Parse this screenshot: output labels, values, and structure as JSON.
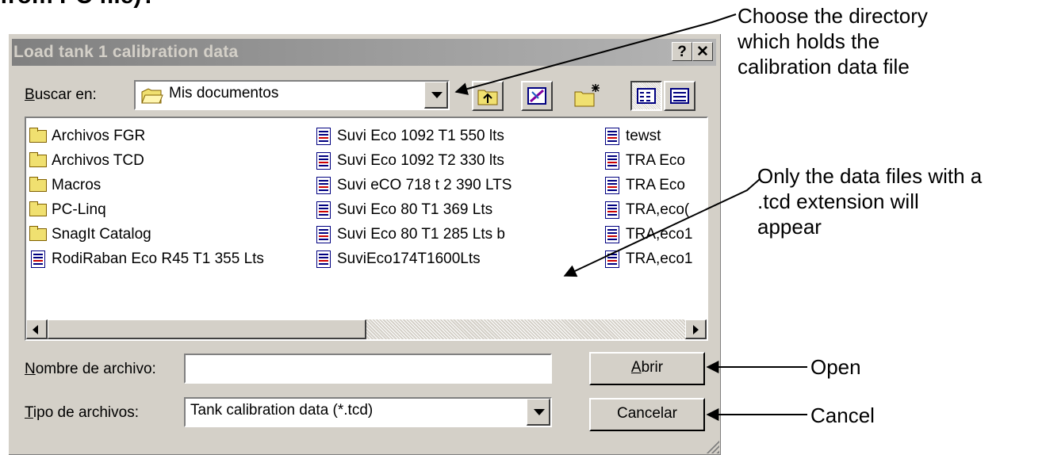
{
  "heading_fragment": "from PC file)?",
  "dialog": {
    "title": "Load tank 1 calibration data",
    "help_button": "?",
    "close_button": "✕",
    "look_in_label_first": "B",
    "look_in_label_rest": "uscar en:",
    "look_in_value": "Mis documentos",
    "file_name_label_first": "N",
    "file_name_label_rest": "ombre de archivo:",
    "file_name_value": "",
    "file_type_label_first": "T",
    "file_type_label_rest": "ipo de archivos:",
    "file_type_value": "Tank calibration data (*.tcd)",
    "open_label_first": "A",
    "open_label_rest": "brir",
    "cancel_label": "Cancelar",
    "files": [
      {
        "name": "Archivos FGR",
        "type": "folder"
      },
      {
        "name": "Archivos TCD",
        "type": "folder"
      },
      {
        "name": "Macros",
        "type": "folder"
      },
      {
        "name": "PC-Linq",
        "type": "folder"
      },
      {
        "name": "SnagIt Catalog",
        "type": "folder"
      },
      {
        "name": "RodiRaban Eco R45 T1 355 Lts",
        "type": "file"
      },
      {
        "name": "Suvi Eco 1092 T1 550 lts",
        "type": "file"
      },
      {
        "name": "Suvi Eco 1092 T2 330 lts",
        "type": "file"
      },
      {
        "name": "Suvi eCO 718 t 2 390 LTS",
        "type": "file"
      },
      {
        "name": "Suvi Eco 80 T1  369 Lts",
        "type": "file"
      },
      {
        "name": "Suvi Eco 80 T1 285 Lts b",
        "type": "file"
      },
      {
        "name": "SuviEco174T1600Lts",
        "type": "file"
      },
      {
        "name": "tewst",
        "type": "file"
      },
      {
        "name": "TRA Eco",
        "type": "file"
      },
      {
        "name": "TRA Eco",
        "type": "file"
      },
      {
        "name": "TRA,eco(",
        "type": "file"
      },
      {
        "name": "TRA,eco1",
        "type": "file"
      },
      {
        "name": "TRA,eco1",
        "type": "file"
      }
    ]
  },
  "annotations": {
    "directory_line1": "Choose the directory",
    "directory_line2": "which holds the",
    "directory_line3": "calibration data file",
    "filter_line1": "Only the data files with a",
    "filter_line2": ".tcd extension will",
    "filter_line3": "appear",
    "open": "Open",
    "cancel": "Cancel"
  }
}
